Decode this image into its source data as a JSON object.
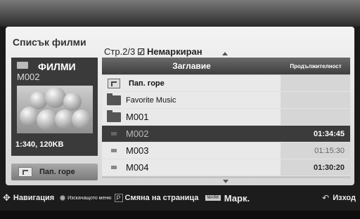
{
  "panel": {
    "title": "Списък филми",
    "page": "Стр.2/3",
    "filter": "Немаркиран"
  },
  "preview": {
    "category": "ФИЛМИ",
    "filename": "M002",
    "info": "1:340, 120KB",
    "up_button_label": "Пап. горе"
  },
  "table": {
    "headers": {
      "name": "Заглавие",
      "duration": "Продължителност"
    },
    "rows": [
      {
        "type": "up-folder",
        "name": "Пап. горе",
        "duration": ""
      },
      {
        "type": "folder",
        "name": "Favorite Music",
        "duration": ""
      },
      {
        "type": "folder",
        "name": "M001",
        "duration": ""
      },
      {
        "type": "file",
        "name": "M002",
        "duration": "01:34:45",
        "selected": true
      },
      {
        "type": "file",
        "name": "M003",
        "duration": "01:15:30"
      },
      {
        "type": "file",
        "name": "M004",
        "duration": "01:30:20"
      }
    ]
  },
  "bottom_bar": {
    "navigation": "Навигация",
    "popup_menu": "Изскачащото меню",
    "page_change": "Смяна на страница",
    "mark_key": "MARK",
    "mark": "Марк.",
    "exit": "Изход"
  },
  "icons": {
    "nav": "navigation-cross-icon",
    "popup": "circle-button-icon",
    "page": "p-button-icon",
    "mark": "mark-button-icon",
    "exit": "back-arrow-icon"
  }
}
